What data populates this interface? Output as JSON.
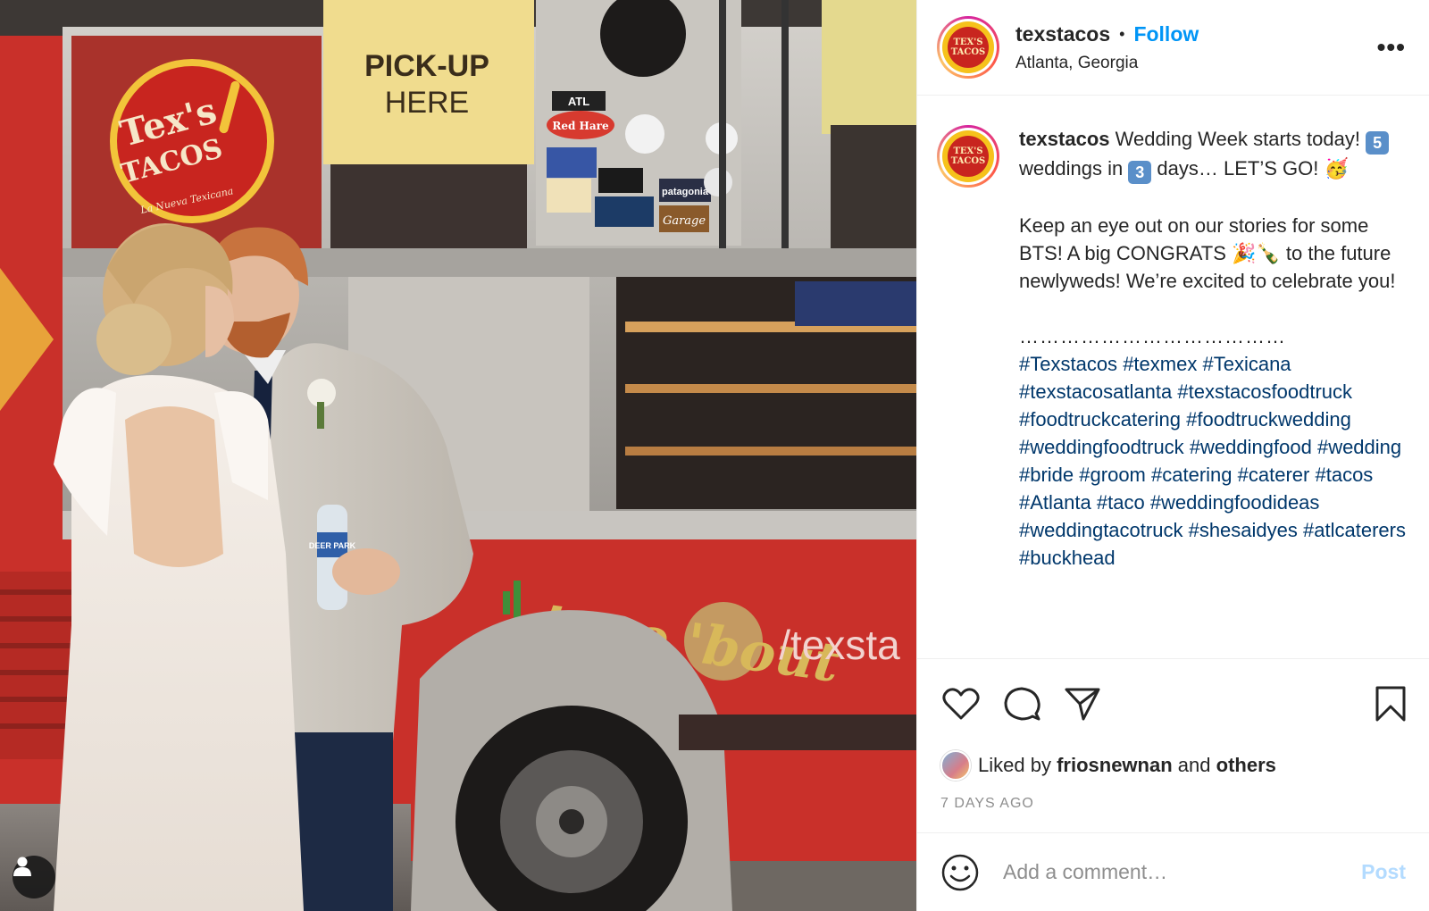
{
  "post": {
    "username": "texstacos",
    "follow_label": "Follow",
    "separator": "•",
    "location": "Atlanta, Georgia",
    "more_label": "•••",
    "avatar_logo_text": "TEX'S TACOS"
  },
  "photo": {
    "sign_pickup_line1": "PICK-UP",
    "sign_pickup_line2": "HERE",
    "logo_line1": "Tex's",
    "logo_line2": "TACOS",
    "logo_tagline": "La Nueva Texicana",
    "banner_text": "taco 'bout",
    "truck_text": "/texsta",
    "bottle_label": "DEER PARK",
    "sticker_atl": "ATL",
    "sticker_redhare": "Red Hare",
    "sticker_patagonia": "patagonia",
    "sticker_garage": "Garage",
    "colors": {
      "truck_red": "#c9302a",
      "steel": "#b9b6b1",
      "sign_yellow": "#f0dc8e"
    }
  },
  "caption": {
    "username": "texstacos",
    "line1": " Wedding Week starts today!",
    "num_five": "5",
    "text_weddings_in": " weddings in ",
    "num_three": "3",
    "text_days": " days… LET’S GO!",
    "emoji_party_face": "🥳",
    "para2_a": "Keep an eye out on our stories for some BTS! A big CONGRATS ",
    "emoji_popper": "🎉",
    "emoji_champagne": "🍾",
    "para2_b": " to the future newlyweds! We’re excited to celebrate you!",
    "dots": "…………………………………",
    "hashtags": [
      "#Texstacos",
      "#texmex",
      "#Texicana",
      "#texstacosatlanta",
      "#texstacosfoodtruck",
      "#foodtruckcatering",
      "#foodtruckwedding",
      "#weddingfoodtruck",
      "#weddingfood",
      "#wedding",
      "#bride",
      "#groom",
      "#catering",
      "#caterer",
      "#tacos",
      "#Atlanta",
      "#taco",
      "#weddingfoodideas",
      "#weddingtacotruck",
      "#shesaidyes",
      "#atlcaterers",
      "#buckhead"
    ]
  },
  "actions": {
    "icons": [
      "heart-icon",
      "comment-icon",
      "share-icon",
      "bookmark-icon"
    ]
  },
  "likes": {
    "prefix": "Liked by ",
    "user": "friosnewnan",
    "middle": " and ",
    "others": "others"
  },
  "timestamp": "7 DAYS AGO",
  "comment": {
    "placeholder": "Add a comment…",
    "post_label": "Post"
  }
}
